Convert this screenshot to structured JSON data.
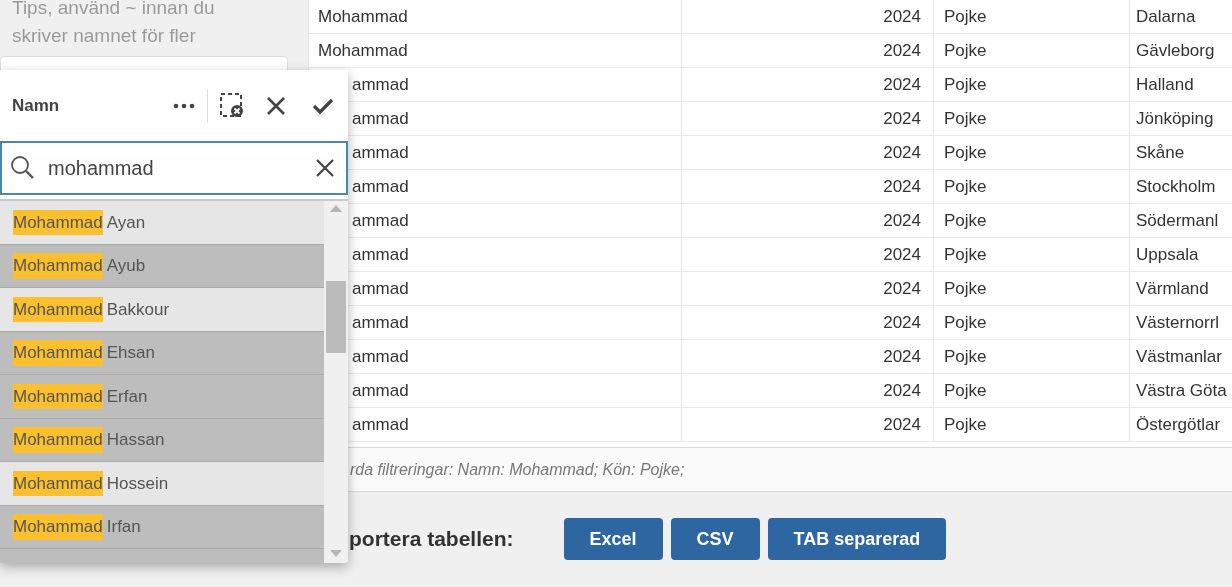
{
  "hint": "Tips, använd ~ innan du skriver namnet för fler",
  "table": {
    "rows": [
      {
        "kind": "full",
        "name": "Mohammad",
        "year": "2024",
        "gender": "Pojke",
        "county": "Dalarna"
      },
      {
        "kind": "full",
        "name": "Mohammad",
        "year": "2024",
        "gender": "Pojke",
        "county": "Gävleborg"
      },
      {
        "kind": "overlapped",
        "name": "ammad",
        "year": "2024",
        "gender": "Pojke",
        "county": "Halland"
      },
      {
        "kind": "overlapped",
        "name": "ammad",
        "year": "2024",
        "gender": "Pojke",
        "county": "Jönköping"
      },
      {
        "kind": "overlapped",
        "name": "ammad",
        "year": "2024",
        "gender": "Pojke",
        "county": "Skåne"
      },
      {
        "kind": "overlapped",
        "name": "ammad",
        "year": "2024",
        "gender": "Pojke",
        "county": "Stockholm"
      },
      {
        "kind": "overlapped",
        "name": "ammad",
        "year": "2024",
        "gender": "Pojke",
        "county": "Södermanl"
      },
      {
        "kind": "overlapped",
        "name": "ammad",
        "year": "2024",
        "gender": "Pojke",
        "county": "Uppsala"
      },
      {
        "kind": "overlapped",
        "name": "ammad",
        "year": "2024",
        "gender": "Pojke",
        "county": "Värmland"
      },
      {
        "kind": "overlapped",
        "name": "ammad",
        "year": "2024",
        "gender": "Pojke",
        "county": "Västernorrl"
      },
      {
        "kind": "overlapped",
        "name": "ammad",
        "year": "2024",
        "gender": "Pojke",
        "county": "Västmanlar"
      },
      {
        "kind": "overlapped",
        "name": "ammad",
        "year": "2024",
        "gender": "Pojke",
        "county": "Västra Göta"
      },
      {
        "kind": "overlapped",
        "name": "ammad",
        "year": "2024",
        "gender": "Pojke",
        "county": "Östergötlar"
      }
    ]
  },
  "filters_text": "rda filtreringar: Namn: Mohammad; Kön: Pojke;",
  "export": {
    "label": "portera tabellen:",
    "buttons": [
      "Excel",
      "CSV",
      "TAB separerad"
    ]
  },
  "popup": {
    "title": "Namn",
    "search_value": "mohammad",
    "items": [
      {
        "match": "Mohammad",
        "rest": "Ayan",
        "dimmed": false
      },
      {
        "match": "Mohammad",
        "rest": "Ayub",
        "dimmed": true
      },
      {
        "match": "Mohammad",
        "rest": "Bakkour",
        "dimmed": false
      },
      {
        "match": "Mohammad",
        "rest": "Ehsan",
        "dimmed": true
      },
      {
        "match": "Mohammad",
        "rest": "Erfan",
        "dimmed": true
      },
      {
        "match": "Mohammad",
        "rest": "Hassan",
        "dimmed": true
      },
      {
        "match": "Mohammad",
        "rest": "Hossein",
        "dimmed": false
      },
      {
        "match": "Mohammad",
        "rest": "Irfan",
        "dimmed": true
      }
    ]
  }
}
